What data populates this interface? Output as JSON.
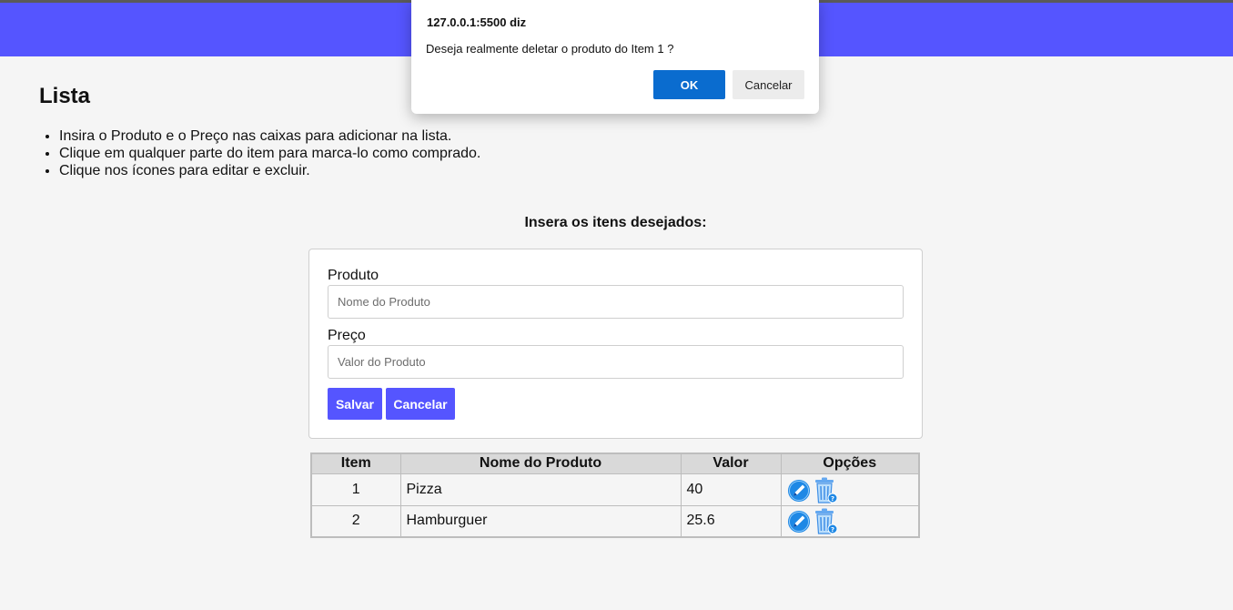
{
  "dialog": {
    "title": "127.0.0.1:5500 diz",
    "message": "Deseja realmente deletar o produto do Item 1 ?",
    "ok_label": "OK",
    "cancel_label": "Cancelar"
  },
  "page": {
    "title": "Lista",
    "instructions": [
      "Insira o Produto e o Preço nas caixas para adicionar na lista.",
      "Clique em qualquer parte do item para marca-lo como comprado.",
      "Clique nos ícones para editar e excluir."
    ],
    "form_heading": "Insera os itens desejados:"
  },
  "form": {
    "product_label": "Produto",
    "product_placeholder": "Nome do Produto",
    "product_value": "",
    "price_label": "Preço",
    "price_placeholder": "Valor do Produto",
    "price_value": "",
    "save_label": "Salvar",
    "cancel_label": "Cancelar"
  },
  "table": {
    "headers": [
      "Item",
      "Nome do Produto",
      "Valor",
      "Opções"
    ],
    "rows": [
      {
        "item": "1",
        "name": "Pizza",
        "value": "40"
      },
      {
        "item": "2",
        "name": "Hamburguer",
        "value": "25.6"
      }
    ],
    "edit_icon": "pencil-icon",
    "delete_icon": "trash-icon"
  },
  "colors": {
    "accent": "#5555ff",
    "dialog_ok": "#0a6ccf",
    "icon_blue": "#1a73e8"
  }
}
